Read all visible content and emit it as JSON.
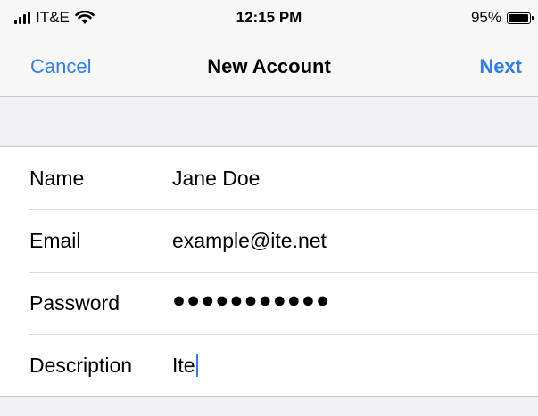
{
  "status_bar": {
    "carrier": "IT&E",
    "time": "12:15 PM",
    "battery": "95%",
    "battery_level": 0.95,
    "signal_icon": "cellular-signal-icon",
    "wifi_icon": "wifi-icon",
    "battery_icon": "battery-icon"
  },
  "nav": {
    "cancel_label": "Cancel",
    "title": "New Account",
    "next_label": "Next"
  },
  "form": {
    "fields": [
      {
        "label": "Name",
        "value": "Jane Doe"
      },
      {
        "label": "Email",
        "value": "example@ite.net"
      },
      {
        "label": "Password",
        "value": "●●●●●●●●●●●"
      },
      {
        "label": "Description",
        "value": "Ite"
      }
    ]
  },
  "colors": {
    "accent": "#2f7cf6",
    "background": "#efeff4",
    "bar": "#f7f7f7"
  }
}
